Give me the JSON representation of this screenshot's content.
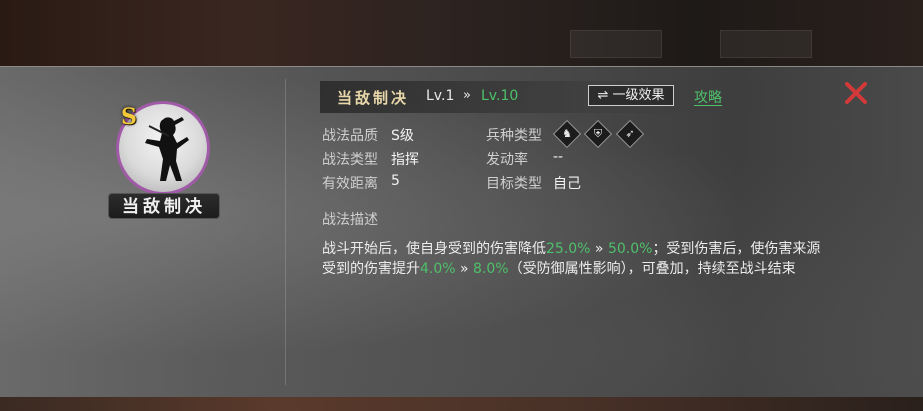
{
  "skill": {
    "grade_badge": "S",
    "name": "当敌制决",
    "level_current": "Lv.1",
    "level_arrow": "»",
    "level_max": "Lv.10",
    "effect_button": "⇌ 一级效果",
    "strategy_link": "攻略"
  },
  "attributes": {
    "quality_label": "战法品质",
    "quality_value": "S级",
    "type_label": "战法类型",
    "type_value": "指挥",
    "range_label": "有效距离",
    "range_value": "5",
    "troop_label": "兵种类型",
    "troop_icons": [
      "cavalry-icon",
      "shield-icon",
      "bow-icon"
    ],
    "rate_label": "发动率",
    "rate_value": "--",
    "target_label": "目标类型",
    "target_value": "自己"
  },
  "description": {
    "title": "战法描述",
    "p1": "战斗开始后，使自身受到的伤害降低",
    "v1a": "25.0%",
    "arrow1": " » ",
    "v1b": "50.0%",
    "p2": "；受到伤害后，使伤害来源受到的伤害提升",
    "v2a": "4.0%",
    "arrow2": " » ",
    "v2b": "8.0%",
    "p3": "（受防御属性影响），可叠加，持续至战斗结束"
  },
  "colors": {
    "accent_green": "#4ec06a",
    "gold": "#f2c83a",
    "close_red": "#d23a3a",
    "portrait_ring": "#a05aa8"
  }
}
